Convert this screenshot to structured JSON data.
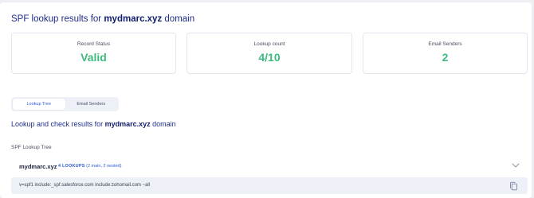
{
  "header": {
    "title_prefix": "SPF lookup results for ",
    "domain": "mydmarc.xyz",
    "title_suffix": " domain"
  },
  "stats": [
    {
      "label": "Record Status",
      "value": "Valid"
    },
    {
      "label": "Lookup count",
      "value": "4/10"
    },
    {
      "label": "Email Senders",
      "value": "2"
    }
  ],
  "tabs": [
    {
      "label": "Lookup Tree",
      "active": true
    },
    {
      "label": "Email Senders",
      "active": false
    }
  ],
  "section": {
    "title_prefix": "Lookup and check results for ",
    "domain": "mydmarc.xyz",
    "title_suffix": " domain"
  },
  "tree": {
    "label": "SPF Lookup Tree",
    "root": {
      "domain": "mydmarc.xyz",
      "badge_strong": "4 LOOKUPS",
      "badge_detail": " (2 main, 2 nested)",
      "record": "v=spf1 include:_spf.salesforce.com include:zohomail.com ~all"
    }
  },
  "icons": {
    "expand": "chevron-down-icon",
    "copy": "copy-icon"
  },
  "colors": {
    "accent": "#2c5ad7",
    "title": "#1f2d8a",
    "success": "#3dbb7e"
  }
}
